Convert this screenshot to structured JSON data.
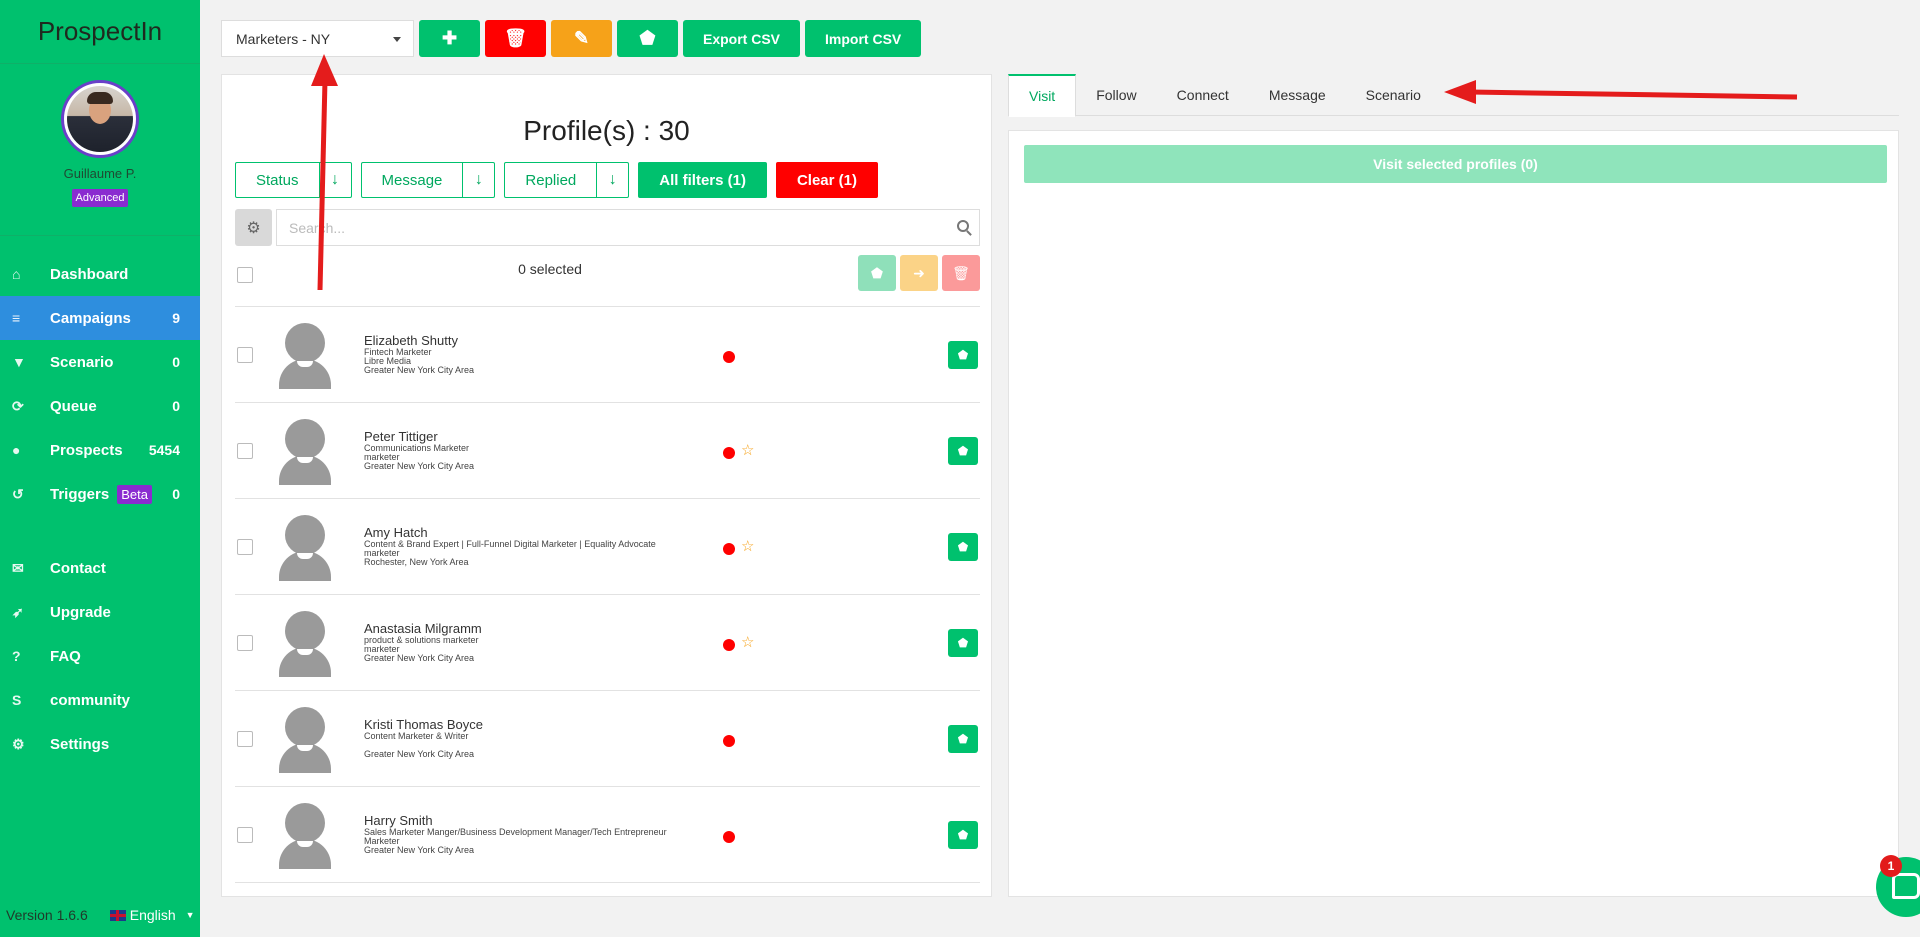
{
  "brand": "ProspectIn",
  "user": {
    "name": "Guillaume P.",
    "plan": "Advanced"
  },
  "nav": [
    {
      "label": "Dashboard",
      "count": "",
      "icon": "home-icon"
    },
    {
      "label": "Campaigns",
      "count": "9",
      "icon": "list-icon",
      "active": true
    },
    {
      "label": "Scenario",
      "count": "0",
      "icon": "filter-icon"
    },
    {
      "label": "Queue",
      "count": "0",
      "icon": "refresh-icon"
    },
    {
      "label": "Prospects",
      "count": "5454",
      "icon": "user-icon"
    },
    {
      "label": "Triggers",
      "badge": "Beta",
      "count": "0",
      "icon": "history-icon"
    }
  ],
  "nav_secondary": [
    {
      "label": "Contact",
      "icon": "envelope-icon"
    },
    {
      "label": "Upgrade",
      "icon": "rocket-icon"
    },
    {
      "label": "FAQ",
      "icon": "question-icon"
    },
    {
      "label": "community",
      "icon": "skype-icon"
    },
    {
      "label": "Settings",
      "icon": "gear-icon"
    }
  ],
  "footer": {
    "version": "Version 1.6.6",
    "language": "English"
  },
  "toolbar": {
    "campaign_select": "Marketers - NY",
    "export_label": "Export CSV",
    "import_label": "Import CSV"
  },
  "list": {
    "title": "Profile(s) : 30",
    "filters": {
      "status": "Status",
      "message": "Message",
      "replied": "Replied",
      "all": "All filters (1)",
      "clear": "Clear (1)"
    },
    "search_placeholder": "Search...",
    "selected": "0 selected"
  },
  "profiles": [
    {
      "name": "Elizabeth Shutty",
      "lines": [
        "Fintech Marketer",
        "Libre Media",
        "Greater New York City Area"
      ],
      "starred": false
    },
    {
      "name": "Peter Tittiger",
      "lines": [
        "Communications Marketer",
        "marketer",
        "Greater New York City Area"
      ],
      "starred": true
    },
    {
      "name": "Amy Hatch",
      "lines": [
        "Content & Brand Expert | Full-Funnel Digital Marketer | Equality Advocate",
        "marketer",
        "Rochester, New York Area"
      ],
      "starred": true
    },
    {
      "name": "Anastasia Milgramm",
      "lines": [
        "product & solutions marketer",
        "marketer",
        "Greater New York City Area"
      ],
      "starred": true
    },
    {
      "name": "Kristi Thomas Boyce",
      "lines": [
        "Content Marketer & Writer",
        "",
        "Greater New York City Area"
      ],
      "starred": false
    },
    {
      "name": "Harry Smith",
      "lines": [
        "Sales Marketer Manger/Business Development Manager/Tech Entrepreneur",
        "Marketer",
        "Greater New York City Area"
      ],
      "starred": false
    }
  ],
  "tabs": [
    "Visit",
    "Follow",
    "Connect",
    "Message",
    "Scenario"
  ],
  "action": {
    "visit_button": "Visit selected profiles (0)"
  },
  "chat": {
    "badge": "1"
  },
  "colors": {
    "primary": "#00c16e",
    "danger": "#ff0000",
    "warning": "#f6a219",
    "active_nav": "#2e8ede",
    "badge_purple": "#8a2bd0"
  }
}
